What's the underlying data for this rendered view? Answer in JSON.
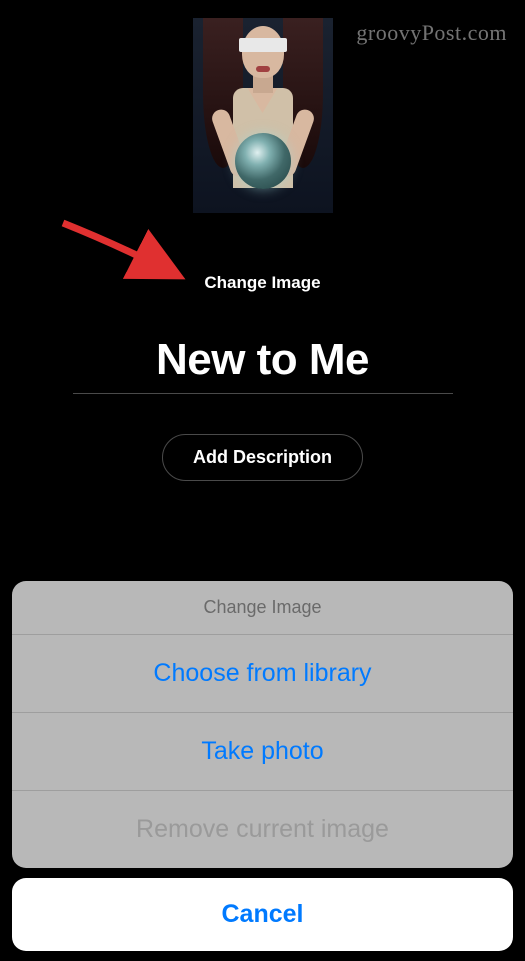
{
  "watermark": "groovyPost.com",
  "editor": {
    "change_image_label": "Change Image",
    "playlist_title": "New to Me",
    "add_description_label": "Add Description"
  },
  "action_sheet": {
    "header": "Change Image",
    "options": [
      {
        "label": "Choose from library",
        "enabled": true
      },
      {
        "label": "Take photo",
        "enabled": true
      },
      {
        "label": "Remove current image",
        "enabled": false
      }
    ],
    "cancel_label": "Cancel"
  }
}
